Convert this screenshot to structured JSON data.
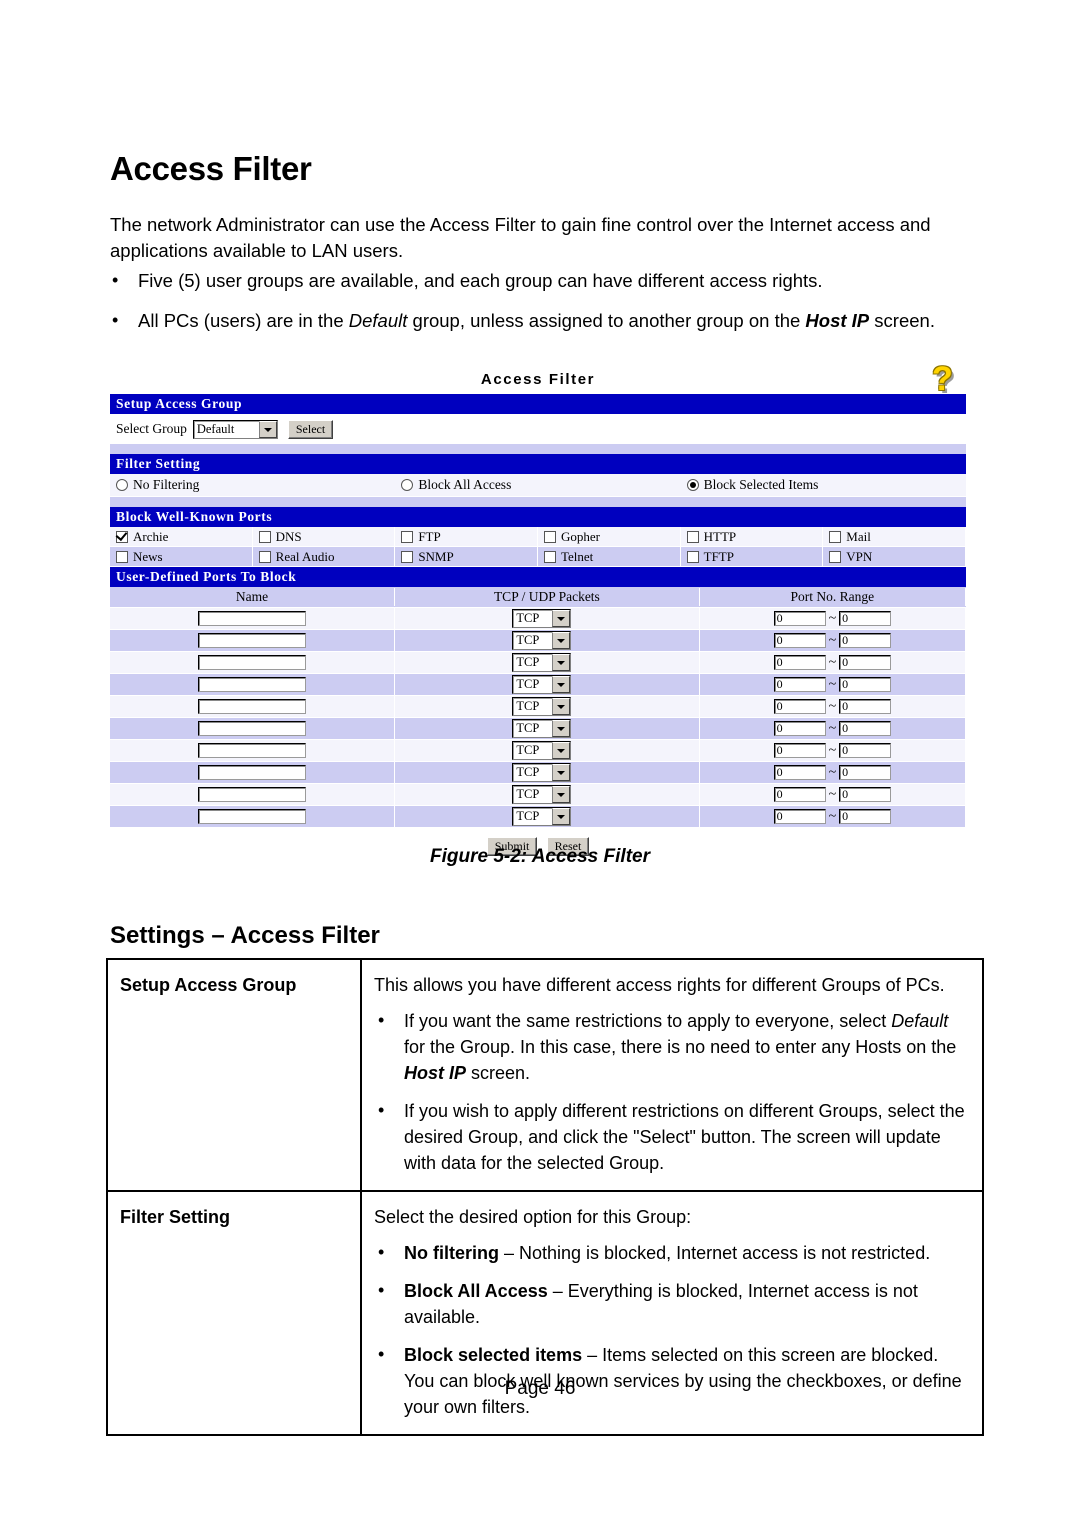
{
  "document": {
    "title": "Access Filter",
    "intro": "The network Administrator can use the Access Filter to gain fine control over the Internet access and applications available to LAN users.",
    "bullets": [
      {
        "text": "Five (5) user groups are available, and each group can have different access rights."
      },
      {
        "pre": "All PCs (users) are in the ",
        "italic": "Default",
        "mid": " group, unless assigned to another group on the ",
        "bolditalic": "Host IP",
        "post": " screen."
      }
    ],
    "figure_caption": "Figure 5-2: Access Filter",
    "page_footer": "Page 46"
  },
  "screenshot": {
    "title": "Access Filter",
    "help_icon": "question-mark-help-icon",
    "setup_access_group": {
      "bar_label": "Setup Access Group",
      "select_group_label": "Select Group",
      "group_value": "Default",
      "select_button": "Select"
    },
    "filter_setting": {
      "bar_label": "Filter Setting",
      "options": [
        {
          "label": "No Filtering",
          "selected": false
        },
        {
          "label": "Block All Access",
          "selected": false
        },
        {
          "label": "Block Selected Items",
          "selected": true
        }
      ]
    },
    "block_well_known_ports": {
      "bar_label": "Block Well-Known Ports",
      "items": [
        {
          "label": "Archie",
          "checked": true
        },
        {
          "label": "DNS",
          "checked": false
        },
        {
          "label": "FTP",
          "checked": false
        },
        {
          "label": "Gopher",
          "checked": false
        },
        {
          "label": "HTTP",
          "checked": false
        },
        {
          "label": "Mail",
          "checked": false
        },
        {
          "label": "News",
          "checked": false
        },
        {
          "label": "Real Audio",
          "checked": false
        },
        {
          "label": "SNMP",
          "checked": false
        },
        {
          "label": "Telnet",
          "checked": false
        },
        {
          "label": "TFTP",
          "checked": false
        },
        {
          "label": "VPN",
          "checked": false
        }
      ]
    },
    "user_defined_ports": {
      "bar_label": "User-Defined Ports To Block",
      "columns": [
        "Name",
        "TCP / UDP Packets",
        "Port No. Range"
      ],
      "range_separator": "~",
      "rows": [
        {
          "name": "",
          "protocol": "TCP",
          "port_start": "0",
          "port_end": "0"
        },
        {
          "name": "",
          "protocol": "TCP",
          "port_start": "0",
          "port_end": "0"
        },
        {
          "name": "",
          "protocol": "TCP",
          "port_start": "0",
          "port_end": "0"
        },
        {
          "name": "",
          "protocol": "TCP",
          "port_start": "0",
          "port_end": "0"
        },
        {
          "name": "",
          "protocol": "TCP",
          "port_start": "0",
          "port_end": "0"
        },
        {
          "name": "",
          "protocol": "TCP",
          "port_start": "0",
          "port_end": "0"
        },
        {
          "name": "",
          "protocol": "TCP",
          "port_start": "0",
          "port_end": "0"
        },
        {
          "name": "",
          "protocol": "TCP",
          "port_start": "0",
          "port_end": "0"
        },
        {
          "name": "",
          "protocol": "TCP",
          "port_start": "0",
          "port_end": "0"
        },
        {
          "name": "",
          "protocol": "TCP",
          "port_start": "0",
          "port_end": "0"
        }
      ]
    },
    "actions": {
      "submit": "Submit",
      "reset": "Reset"
    }
  },
  "settings": {
    "heading": "Settings – Access Filter",
    "rows": [
      {
        "key": "Setup Access Group",
        "lead": "This allows you have different access rights for different Groups of PCs.",
        "bullets": [
          {
            "pre": "If you want the same restrictions to apply to everyone, select ",
            "italic": "Default",
            "mid": " for the Group. In this case, there is no need to enter any Hosts on the ",
            "bolditalic": "Host IP",
            "post": " screen."
          },
          {
            "pre": "If you wish to apply different restrictions on different Groups, select the desired Group, and click the \"Select\" button. The screen will update with data for the selected Group.",
            "italic": "",
            "mid": "",
            "bolditalic": "",
            "post": ""
          }
        ]
      },
      {
        "key": "Filter Setting",
        "lead": "Select the desired option for this Group:",
        "bullets": [
          {
            "bold": "No filtering",
            "post": " – Nothing is blocked, Internet access is not restricted."
          },
          {
            "bold": "Block All Access",
            "post": " – Everything is blocked, Internet access is not available."
          },
          {
            "bold": "Block selected items",
            "post": " – Items selected on this screen are blocked. You can block well known services by using the checkboxes, or define your own filters."
          }
        ]
      }
    ]
  },
  "colors": {
    "header_bar": "#0000bf",
    "row_alt": "#ccccf2",
    "row_main": "#f4f4fc",
    "help_icon": "#ffd400"
  }
}
